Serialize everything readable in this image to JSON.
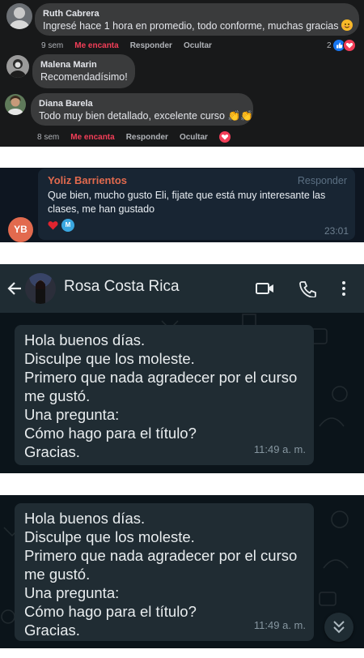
{
  "fb_comments": [
    {
      "name": "Ruth Cabrera",
      "text": "Ingresé hace 1 hora en promedio, todo conforme, muchas gracias",
      "time": "9 sem",
      "love": "Me encanta",
      "reply": "Responder",
      "hide": "Ocultar",
      "reaction_count": "2",
      "emoji": "smiling-face"
    },
    {
      "name": "Malena Marin",
      "text": "Recomendadísimo!"
    },
    {
      "name": "Diana Barela",
      "text": "Todo muy bien detallado, excelente curso 👏👏",
      "time": "8 sem",
      "love": "Me encanta",
      "reply": "Responder",
      "hide": "Ocultar"
    }
  ],
  "reply_card": {
    "avatar_initials": "YB",
    "name": "Yoliz Barrientos",
    "action": "Responder",
    "text_line1": "Que bien, mucho gusto Eli, fijate que está muy interesante las",
    "text_line2": "clases, me han gustado",
    "reaction_badge": "M",
    "time": "23:01"
  },
  "whatsapp": {
    "contact_name": "Rosa Costa Rica",
    "message_lines": [
      "Hola buenos días.",
      "Disculpe que los moleste.",
      "Primero que nada agradecer por el curso",
      "me gustó.",
      "Una pregunta:",
      "Cómo hago para el título?",
      "Gracias."
    ],
    "time": "11:49 a. m."
  },
  "colors": {
    "fb_bg": "#18191a",
    "fb_bubble": "#3a3b3c",
    "love_red": "#f33e58",
    "reply_name": "#e26a4e",
    "wa_bg": "#0b141a",
    "wa_header": "#1f2c33",
    "wa_bubble": "#202c33"
  }
}
